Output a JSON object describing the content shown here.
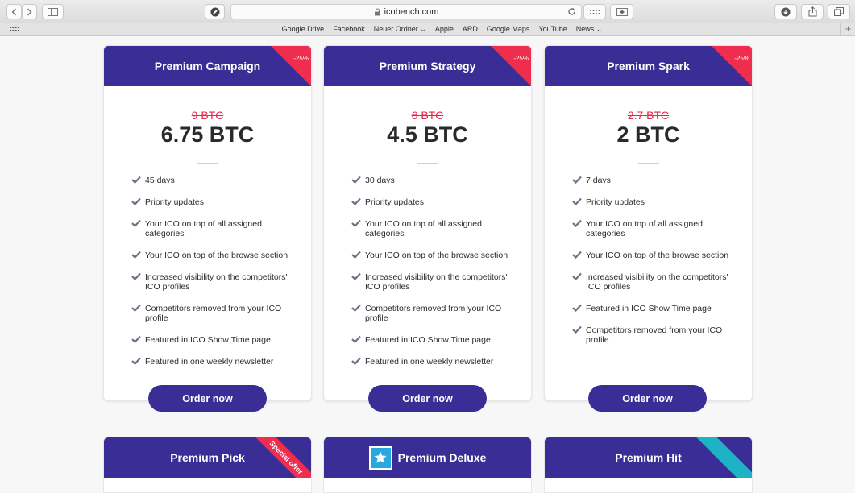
{
  "browser": {
    "url": "icobench.com",
    "bookmarks": [
      "Google Drive",
      "Facebook",
      "Neuer Ordner",
      "Apple",
      "ARD",
      "Google Maps",
      "YouTube",
      "News"
    ],
    "plus_label": "+"
  },
  "cards": [
    {
      "title": "Premium Campaign",
      "discount": "-25%",
      "old_price": "9 BTC",
      "price": "6.75 BTC",
      "features": [
        "45 days",
        "Priority updates",
        "Your ICO on top of all assigned categories",
        "Your ICO on top of the browse section",
        "Increased visibility on the competitors' ICO profiles",
        "Competitors removed from your ICO profile",
        "Featured in ICO Show Time page",
        "Featured in one weekly newsletter"
      ],
      "button": "Order now"
    },
    {
      "title": "Premium Strategy",
      "discount": "-25%",
      "old_price": "6 BTC",
      "price": "4.5 BTC",
      "features": [
        "30 days",
        "Priority updates",
        "Your ICO on top of all assigned categories",
        "Your ICO on top of the browse section",
        "Increased visibility on the competitors' ICO profiles",
        "Competitors removed from your ICO profile",
        "Featured in ICO Show Time page",
        "Featured in one weekly newsletter"
      ],
      "button": "Order now"
    },
    {
      "title": "Premium Spark",
      "discount": "-25%",
      "old_price": "2.7 BTC",
      "price": "2 BTC",
      "features": [
        "7 days",
        "Priority updates",
        "Your ICO on top of all assigned categories",
        "Your ICO on top of the browse section",
        "Increased visibility on the competitors' ICO profiles",
        "Featured in ICO Show Time page",
        "Competitors removed from your ICO profile"
      ],
      "button": "Order now"
    }
  ],
  "lower_cards": [
    {
      "title": "Premium Pick",
      "badge": "Special offer"
    },
    {
      "title": "Premium Deluxe"
    },
    {
      "title": "Premium Hit"
    }
  ],
  "colors": {
    "brand": "#3a2d96",
    "discount": "#ef2d4e",
    "old_price": "#e8284a",
    "teal_ribbon": "#1eb3c4",
    "star_badge": "#29a8e0"
  }
}
